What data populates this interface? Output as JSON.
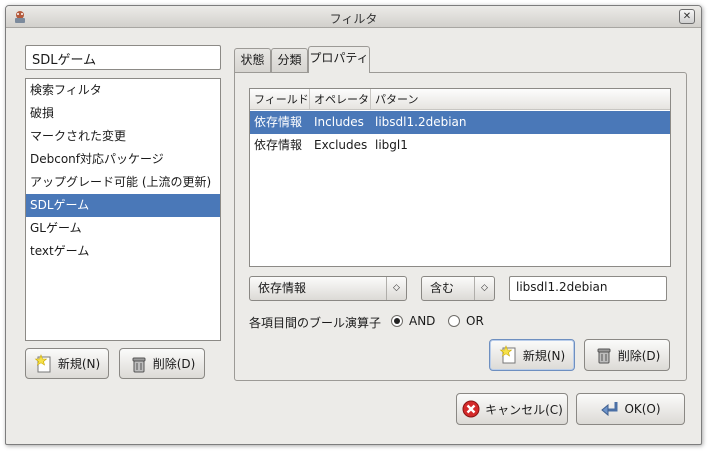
{
  "window": {
    "title": "フィルタ",
    "close_glyph": "✕"
  },
  "left": {
    "name_value": "SDLゲーム",
    "filters": [
      "検索フィルタ",
      "破損",
      "マークされた変更",
      "Debconf対応パッケージ",
      "アップグレード可能 (上流の更新)",
      "SDLゲーム",
      "GLゲーム",
      "textゲーム"
    ],
    "selected_index": 5,
    "new_button": "新規(N)",
    "delete_button": "削除(D)"
  },
  "tabs": [
    {
      "label": "状態"
    },
    {
      "label": "分類"
    },
    {
      "label": "プロパティ"
    }
  ],
  "active_tab": 2,
  "properties": {
    "columns": [
      "フィールド",
      "オペレータ",
      "パターン"
    ],
    "rows": [
      {
        "field": "依存情報",
        "operator": "Includes",
        "pattern": "libsdl1.2debian"
      },
      {
        "field": "依存情報",
        "operator": "Excludes",
        "pattern": "libgl1"
      }
    ],
    "selected_row": 0,
    "field_combo": "依存情報",
    "operator_combo": "含む",
    "pattern_value": "libsdl1.2debian",
    "bool_label": "各項目間のブール演算子",
    "and_label": "AND",
    "or_label": "OR",
    "bool_selected": "AND",
    "new_button": "新規(N)",
    "delete_button": "削除(D)"
  },
  "footer": {
    "cancel_button": "キャンセル(C)",
    "ok_button": "OK(O)"
  },
  "colors": {
    "selection": "#4a78b8",
    "window_bg": "#ecebe8",
    "cancel_red": "#d42a2a"
  },
  "icons": {
    "app": "app-icon",
    "new": "new-icon",
    "delete": "trash-icon",
    "cancel": "cancel-icon",
    "ok": "ok-arrow-icon",
    "combo": "updown-arrow-icon"
  }
}
